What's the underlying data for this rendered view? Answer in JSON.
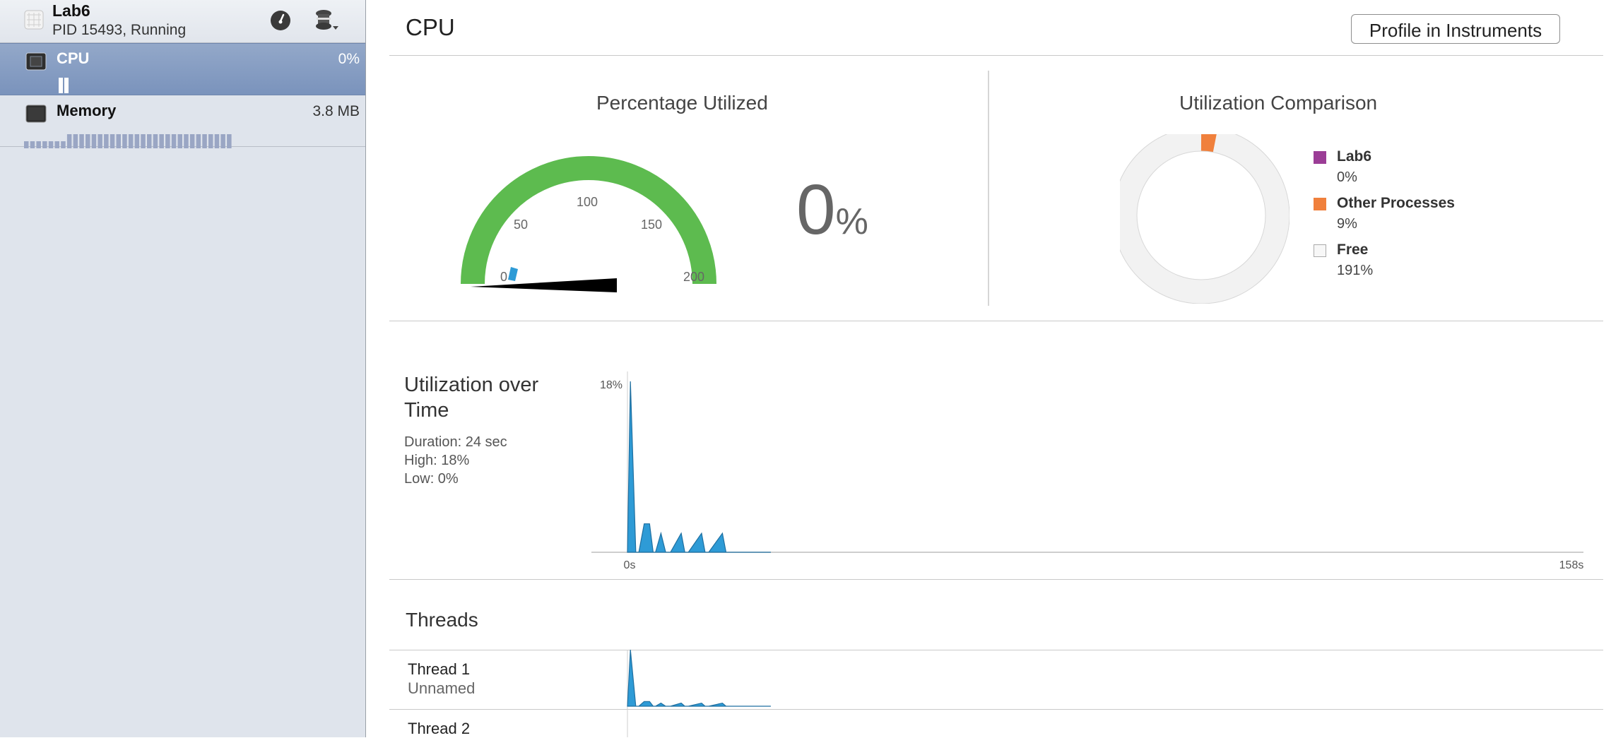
{
  "process": {
    "name": "Lab6",
    "status": "PID 15493, Running"
  },
  "nav": [
    {
      "label": "CPU",
      "value": "0%"
    },
    {
      "label": "Memory",
      "value": "3.8 MB"
    }
  ],
  "main": {
    "title": "CPU",
    "profile_button": "Profile in Instruments"
  },
  "gauge": {
    "title": "Percentage Utilized",
    "tick_labels": [
      "0",
      "50",
      "100",
      "150",
      "200"
    ],
    "max": 200,
    "value_percent": 0,
    "big_value": "0",
    "big_unit": "%",
    "colors": {
      "arc": "#5dbb4f",
      "needle": "#000000",
      "marker": "#2e9bd6"
    }
  },
  "comparison": {
    "title": "Utilization Comparison",
    "legend": [
      {
        "name": "Lab6",
        "value": "0%",
        "color": "#9b3d96"
      },
      {
        "name": "Other Processes",
        "value": "9%",
        "color": "#f0803c"
      },
      {
        "name": "Free",
        "value": "191%",
        "color": "#f2f2f2"
      }
    ]
  },
  "chart_data": {
    "type": "area",
    "title": "Utilization over Time",
    "stats": [
      "Duration: 24 sec",
      "High: 18%",
      "Low: 0%"
    ],
    "y_max_label": "18%",
    "x_start_label": "0s",
    "x_end_label": "158s",
    "xlim": [
      0,
      158
    ],
    "ylim": [
      0,
      18
    ],
    "x": [
      0,
      0.5,
      1.4,
      1.9,
      2.8,
      3.7,
      4.3,
      4.7,
      5.6,
      6.4,
      6.8,
      7.2,
      9.0,
      9.6,
      10.2,
      12.4,
      13.0,
      13.6,
      15.9,
      16.5,
      17.1,
      24.0
    ],
    "values": [
      0,
      18,
      0,
      0,
      3,
      3,
      0,
      0,
      2,
      0,
      0,
      0,
      2,
      0,
      0,
      2,
      0,
      0,
      2,
      0,
      0,
      0
    ],
    "color": "#2e9bd6"
  },
  "threads": {
    "title": "Threads",
    "items": [
      {
        "name": "Thread 1",
        "sub": "Unnamed"
      },
      {
        "name": "Thread 2",
        "sub": ""
      }
    ]
  }
}
